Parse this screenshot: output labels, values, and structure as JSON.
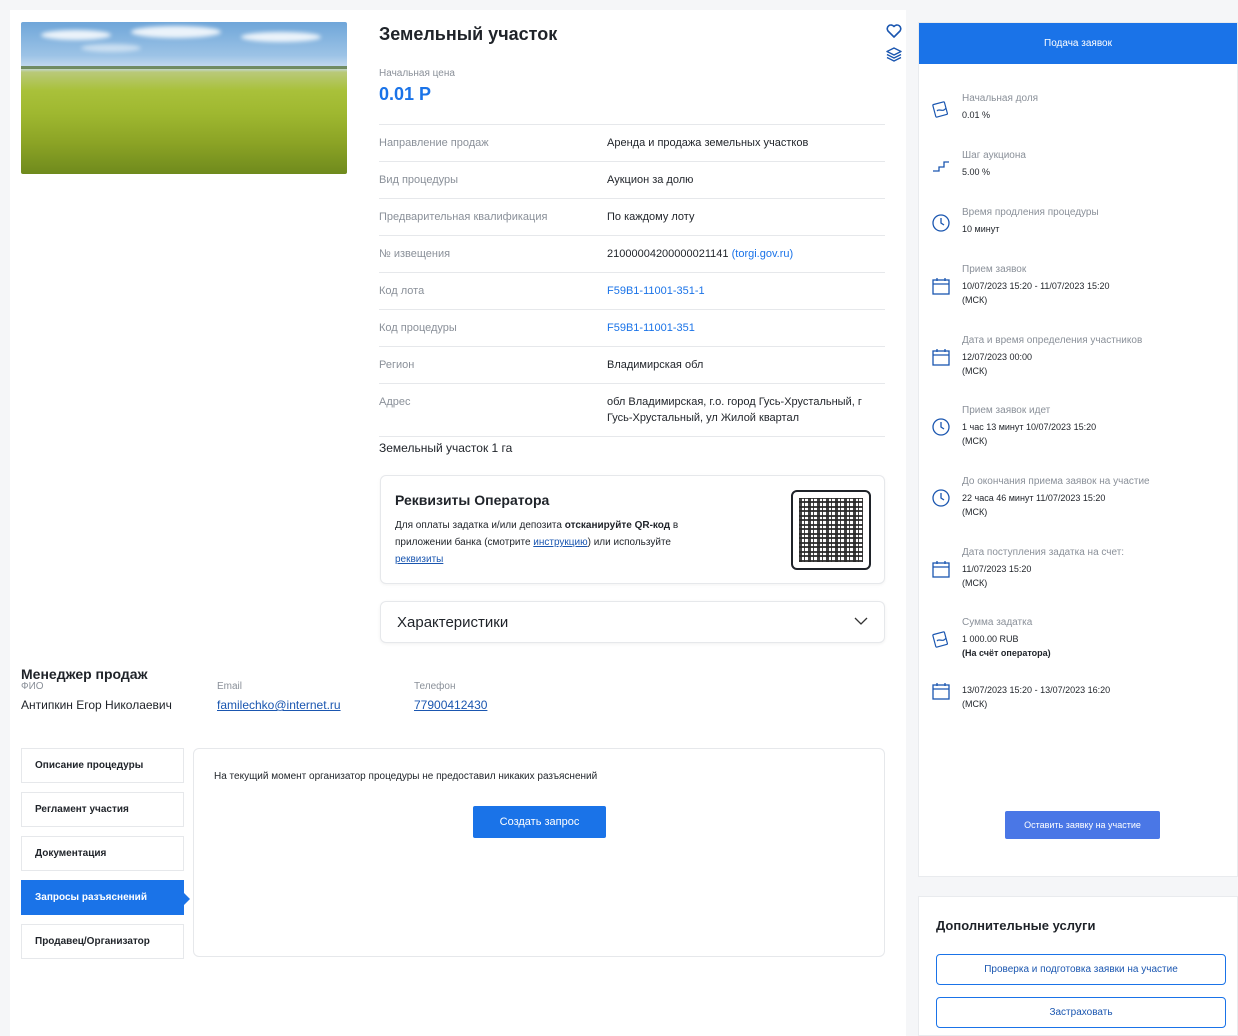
{
  "lot": {
    "title": "Земельный участок",
    "price_label": "Начальная цена",
    "price_value": "0.01 Р",
    "description": "Земельный участок 1 га"
  },
  "properties": [
    {
      "key": "Направление продаж",
      "value": "Аренда и продажа земельных участков"
    },
    {
      "key": "Вид процедуры",
      "value": "Аукцион за долю"
    },
    {
      "key": "Предварительная квалификация",
      "value": "По каждому лоту"
    },
    {
      "key": "№ извещения",
      "value": "21000004200000021141",
      "link": "(torgi.gov.ru)"
    },
    {
      "key": "Код лота",
      "value": "F59B1-11001-351-1"
    },
    {
      "key": "Код процедуры",
      "value": "F59B1-11001-351"
    },
    {
      "key": "Регион",
      "value": "Владимирская обл"
    },
    {
      "key": "Адрес",
      "value": "обл Владимирская, г.о. город Гусь-Хрустальный, г Гусь-Хрустальный, ул Жилой квартал"
    }
  ],
  "operator": {
    "title": "Реквизиты Оператора",
    "text_1": "Для оплаты задатка и/или депозита ",
    "text_bold": "отсканируйте QR-код",
    "text_2": " в приложении банка (смотрите ",
    "link_instruction": "инструкцию",
    "text_3": ") или используйте ",
    "link_requisites": "реквизиты"
  },
  "characteristics_label": "Характеристики",
  "manager": {
    "title": "Менеджер продаж",
    "fio_label": "ФИО",
    "fio": "Антипкин Егор Николаевич",
    "email_label": "Email",
    "email": "familechko@internet.ru",
    "phone_label": "Телефон",
    "phone": "77900412430"
  },
  "tabs": [
    {
      "label": "Описание процедуры",
      "active": false
    },
    {
      "label": "Регламент участия",
      "active": false
    },
    {
      "label": "Документация",
      "active": false
    },
    {
      "label": "Запросы разъяснений",
      "active": true
    },
    {
      "label": "Продавец/Организатор",
      "active": false
    }
  ],
  "qa": {
    "empty_text": "На текущий момент организатор процедуры не предоставил никаких разъяснений",
    "create_button": "Создать запрос"
  },
  "sidebar": {
    "header": "Подача заявок",
    "items": [
      {
        "icon": "money-icon",
        "label": "Начальная доля",
        "lines": [
          "0.01 %"
        ]
      },
      {
        "icon": "step-icon",
        "label": "Шаг аукциона",
        "lines": [
          "5.00 %"
        ]
      },
      {
        "icon": "clock-icon",
        "label": "Время продления процедуры",
        "lines": [
          "10 минут"
        ]
      },
      {
        "icon": "calendar-icon",
        "label": "Прием заявок",
        "lines": [
          "10/07/2023 15:20  - 11/07/2023 15:20",
          "(МСК)"
        ]
      },
      {
        "icon": "calendar-icon",
        "label": "Дата и время определения участников",
        "lines": [
          "12/07/2023 00:00",
          "(МСК)"
        ]
      },
      {
        "icon": "clock-icon",
        "label": "Прием заявок идет",
        "lines": [
          "1 час 13 минут 10/07/2023 15:20",
          "(МСК)"
        ]
      },
      {
        "icon": "clock-icon",
        "label": "До окончания приема заявок на участие",
        "lines": [
          "22 часа 46 минут 11/07/2023 15:20",
          "(МСК)"
        ]
      },
      {
        "icon": "calendar-icon",
        "label": "Дата поступления задатка на счет:",
        "lines": [
          "11/07/2023 15:20",
          "(МСК)"
        ]
      },
      {
        "icon": "money-icon",
        "label": "Сумма задатка",
        "lines": [
          "1 000.00 RUB",
          "(На счёт оператора)"
        ]
      },
      {
        "icon": "calendar-icon",
        "label": "",
        "lines": [
          "13/07/2023 15:20 - 13/07/2023 16:20",
          "(МСК)"
        ]
      }
    ],
    "apply_button": "Оставить заявку на участие"
  },
  "extra": {
    "title": "Дополнительные услуги",
    "btn_check": "Проверка и подготовка заявки на участие",
    "btn_insure": "Застраховать"
  },
  "colors": {
    "accent": "#1a73e8",
    "link": "#1a56b0",
    "muted": "#8a9099"
  }
}
